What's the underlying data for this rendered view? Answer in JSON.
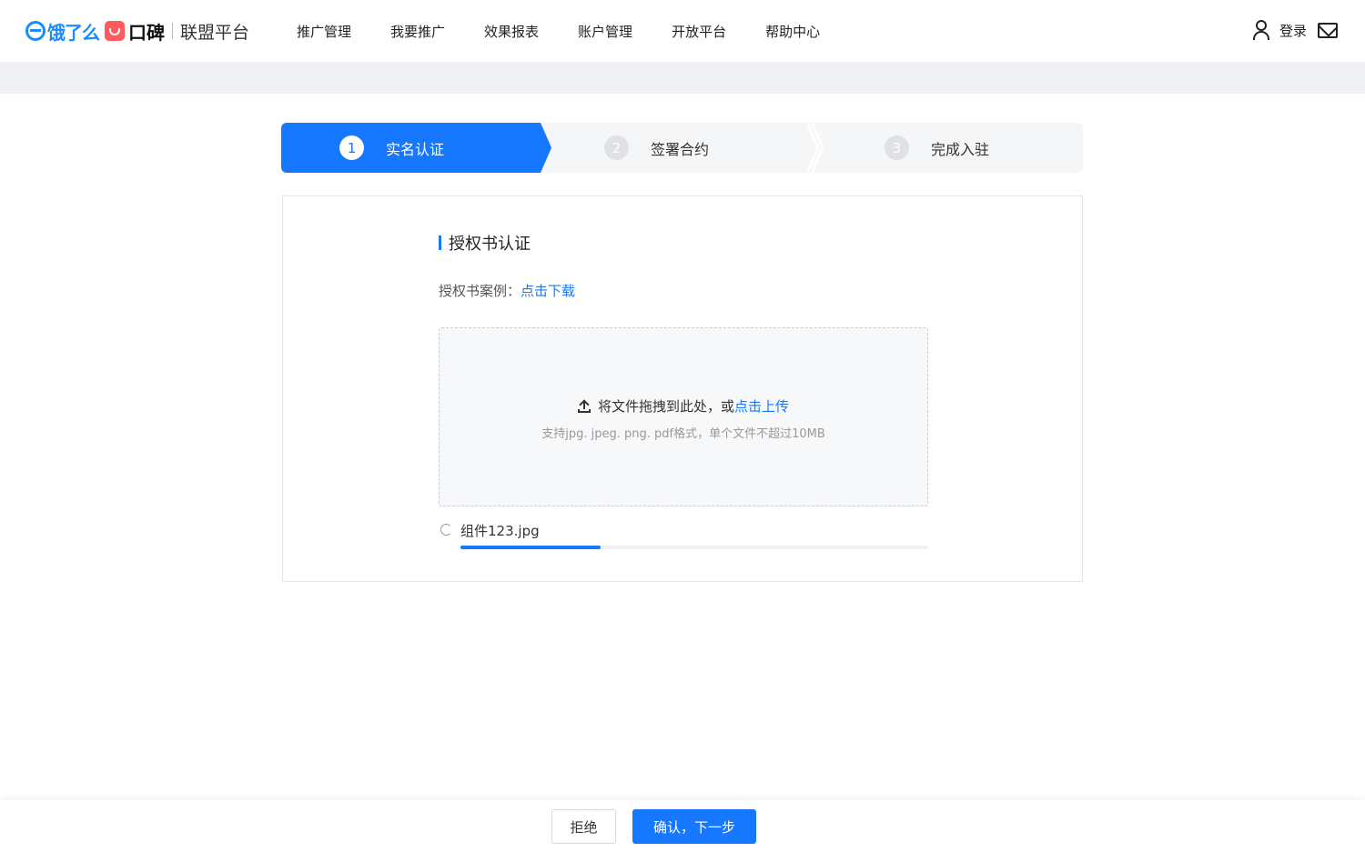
{
  "brand": {
    "eleme": "饿了么",
    "koubei": "口碑",
    "platform": "联盟平台"
  },
  "nav": {
    "items": [
      "推广管理",
      "我要推广",
      "效果报表",
      "账户管理",
      "开放平台",
      "帮助中心"
    ]
  },
  "header_right": {
    "login_label": "登录",
    "user_icon": "user-icon",
    "mail_icon": "mail-icon"
  },
  "steps": [
    {
      "num": "1",
      "label": "实名认证",
      "state": "active"
    },
    {
      "num": "2",
      "label": "签署合约",
      "state": "inactive"
    },
    {
      "num": "3",
      "label": "完成入驻",
      "state": "inactive"
    }
  ],
  "card": {
    "title": "授权书认证",
    "sample_label": "授权书案例：",
    "sample_link": "点击下载",
    "dropzone": {
      "main_text": "将文件拖拽到此处，或",
      "link_text": "点击上传",
      "hint": "支持jpg. jpeg. png. pdf格式，单个文件不超过10MB"
    },
    "file": {
      "name": "组件123.jpg",
      "progress_percent": 30
    }
  },
  "footer": {
    "reject_label": "拒绝",
    "confirm_label": "确认，下一步"
  },
  "colors": {
    "accent": "#1677ff",
    "brand_red": "#ff5a5f",
    "brand_blue": "#1a8cff"
  }
}
